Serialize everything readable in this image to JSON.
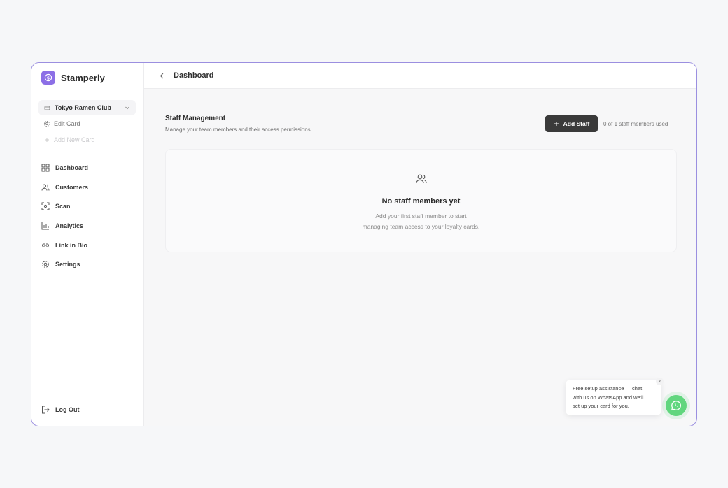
{
  "brand": {
    "name": "Stamperly"
  },
  "sidebar": {
    "card_selector": "Tokyo Ramen Club",
    "edit_card": "Edit Card",
    "add_new_card": "Add New Card",
    "nav": [
      "Dashboard",
      "Customers",
      "Scan",
      "Analytics",
      "Link in Bio",
      "Settings"
    ],
    "logout": "Log Out"
  },
  "header": {
    "title": "Dashboard"
  },
  "staff": {
    "title": "Staff Management",
    "subtitle": "Manage your team members and their access permissions",
    "add_button": "Add Staff",
    "usage": "0 of 1 staff members used",
    "empty_title": "No staff members yet",
    "empty_line1": "Add your first staff member to start",
    "empty_line2": "managing team access to your loyalty cards."
  },
  "whatsapp": {
    "line1": "Free setup assistance — chat",
    "line2": "with us on WhatsApp and we'll",
    "line3": "set up your card for you.",
    "close": "×"
  },
  "colors": {
    "accent": "#8c6fe6",
    "button_dark": "#3a3a3a",
    "whatsapp": "#61d67e"
  }
}
